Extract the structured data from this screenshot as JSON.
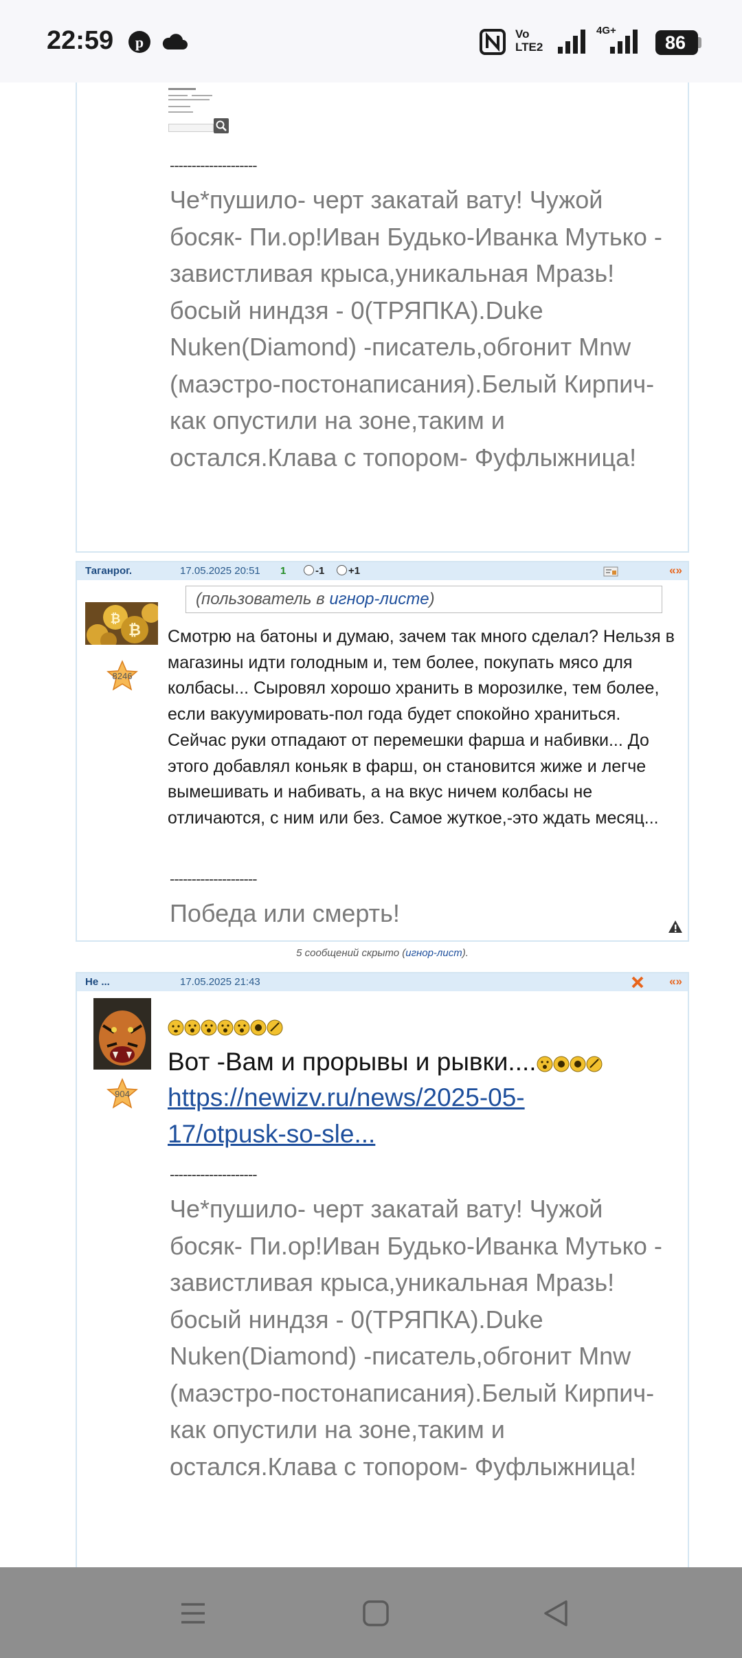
{
  "status_bar": {
    "time": "22:59",
    "network_label_1": "Vo",
    "network_label_2": "LTE2",
    "network_label_3": "4G+",
    "battery": "86"
  },
  "posts": [
    {
      "signature_separator": "--------------------",
      "signature_text": "Че*пушило- черт закатай вату! Чужой босяк- Пи.ор!Иван Будько-Иванка Мутько - завистливая крыса,уникальная Мразь!босый ниндзя - 0(ТРЯПКА).Duke Nuken(Diamond) -писатель,обгонит Mnw (маэстро-постонаписания).Белый Кирпич- как опустили на зоне,таким и остался.Клава с топором- Фуфлыжница!"
    },
    {
      "author": "Таганрог.",
      "date": "17.05.2025 20:51",
      "rating": "1",
      "vote_minus": "-1",
      "vote_plus": "+1",
      "arrows": "«»",
      "avatar_score": "8246",
      "ignore_prefix": "(пользователь в ",
      "ignore_link": "игнор-листе",
      "ignore_suffix": ")",
      "text": "Смотрю на батоны и думаю, зачем так много сделал? Нельзя в магазины идти голодным и, тем более, покупать мясо для колбасы... Сыровял хорошо хранить в морозилке, тем более, если вакуумировать-пол года будет спокойно храниться. Сейчас руки отпадают от перемешки фарша и набивки... До этого добавлял коньяк в фарш, он становится жиже и легче вымешивать и набивать, а на вкус ничем колбасы не отличаются, с ним или без. Самое жуткое,-это ждать месяц...",
      "signature_separator": "--------------------",
      "signature_text": "Победа или смерть!"
    },
    {
      "hidden_prefix": "5 сообщений скрыто (",
      "hidden_link": "игнор-лист",
      "hidden_suffix": ")."
    },
    {
      "author": "Не ...",
      "date": "17.05.2025 21:43",
      "arrows": "«»",
      "avatar_score": "904",
      "headline": "Вот -Вам и прорывы и рывки....",
      "link_text": "https://newizv.ru/news/2025-05-17/otpusk-so-sle...",
      "signature_separator": "--------------------",
      "signature_text": "Че*пушило- черт закатай вату! Чужой босяк- Пи.ор!Иван Будько-Иванка Мутько - завистливая крыса,уникальная Мразь!босый ниндзя - 0(ТРЯПКА).Duke Nuken(Diamond) -писатель,обгонит Mnw (маэстро-постонаписания).Белый Кирпич- как опустили на зоне,таким и остался.Клава с топором- Фуфлыжница!"
    }
  ],
  "colors": {
    "header_bg": "#dcebf8",
    "border": "#d4e6f2",
    "accent_orange": "#e8641b",
    "link": "#1e4f9c",
    "signature_gray": "#7a7a7a"
  }
}
